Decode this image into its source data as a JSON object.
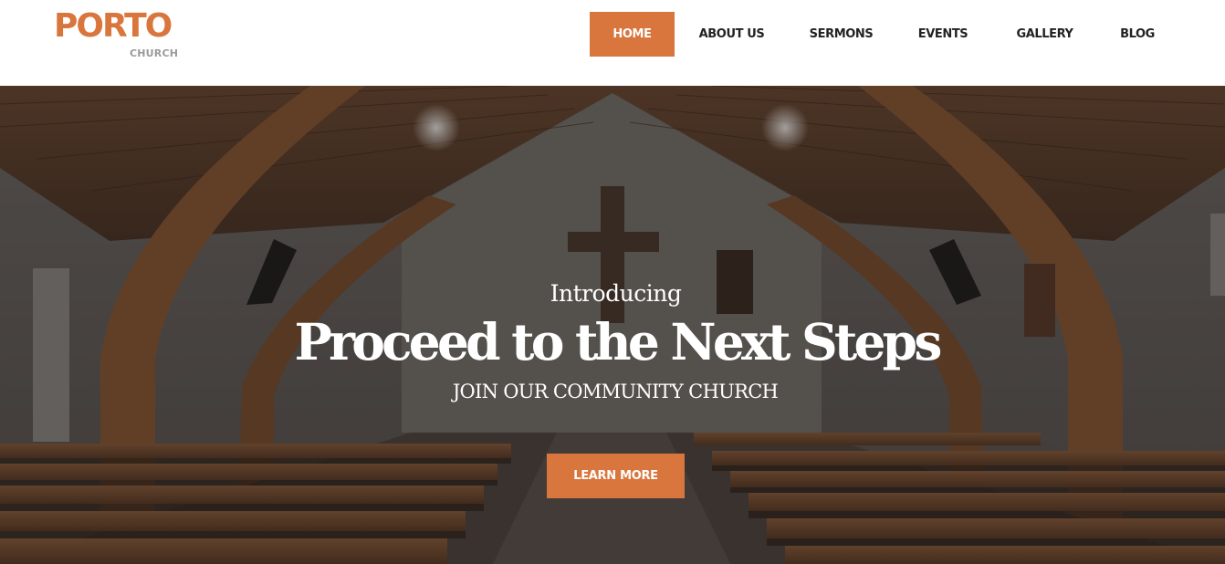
{
  "brand": {
    "name": "PORTO",
    "sub": "CHURCH",
    "accent_color": "#d9763e"
  },
  "nav": {
    "items": [
      {
        "label": "HOME",
        "active": true
      },
      {
        "label": "ABOUT US",
        "active": false
      },
      {
        "label": "SERMONS",
        "active": false
      },
      {
        "label": "EVENTS",
        "active": false
      },
      {
        "label": "GALLERY",
        "active": false
      },
      {
        "label": "BLOG",
        "active": false
      }
    ]
  },
  "hero": {
    "intro": "Introducing",
    "title": "Proceed to the Next Steps",
    "subtitle": "JOIN OUR COMMUNITY CHURCH",
    "button_label": "LEARN MORE"
  }
}
